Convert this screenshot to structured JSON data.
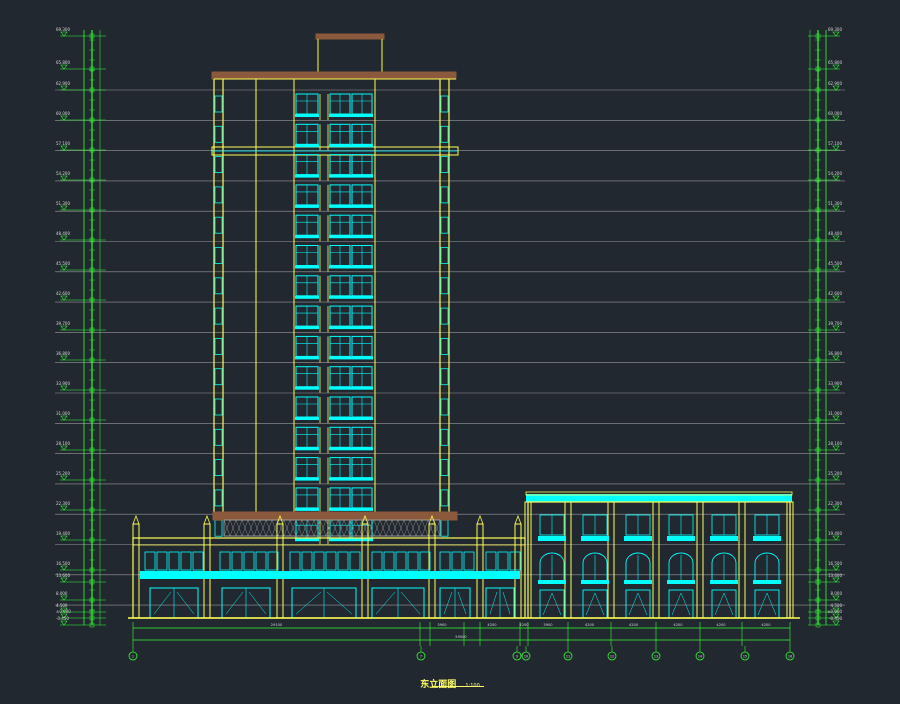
{
  "drawing": {
    "title": "东立面图",
    "scale": "1:100"
  },
  "colors": {
    "background": "#212830",
    "yellow": "#ffff55",
    "cyan": "#00ffff",
    "green": "#33ff33",
    "roof": "#8b5a3c",
    "white": "#d8d8d8"
  },
  "levels": {
    "left": [
      "69.300",
      "65.800",
      "62.900",
      "60.000",
      "57.100",
      "54.200",
      "51.300",
      "48.400",
      "45.500",
      "42.600",
      "39.700",
      "36.800",
      "33.900",
      "31.000",
      "28.100",
      "25.200",
      "22.300",
      "19.400",
      "16.500",
      "13.600",
      "8.000",
      "4.500",
      "±0.000",
      "-0.450"
    ],
    "right": [
      "69.300",
      "65.800",
      "62.900",
      "60.000",
      "57.100",
      "54.200",
      "51.300",
      "48.400",
      "45.500",
      "42.600",
      "39.700",
      "36.800",
      "33.900",
      "31.000",
      "28.100",
      "25.200",
      "22.300",
      "19.400",
      "16.500",
      "13.600",
      "8.000",
      "4.500",
      "±0.000",
      "-0.450"
    ]
  },
  "dimensions": {
    "overall": "59500",
    "segments": [
      "29100",
      "3900",
      "4200",
      "3900",
      "4200",
      "4200",
      "4200",
      "4200",
      "4200",
      "4200"
    ]
  },
  "axes": [
    "1",
    "7",
    "9",
    "10",
    "11",
    "12",
    "13",
    "14",
    "15",
    "16"
  ]
}
